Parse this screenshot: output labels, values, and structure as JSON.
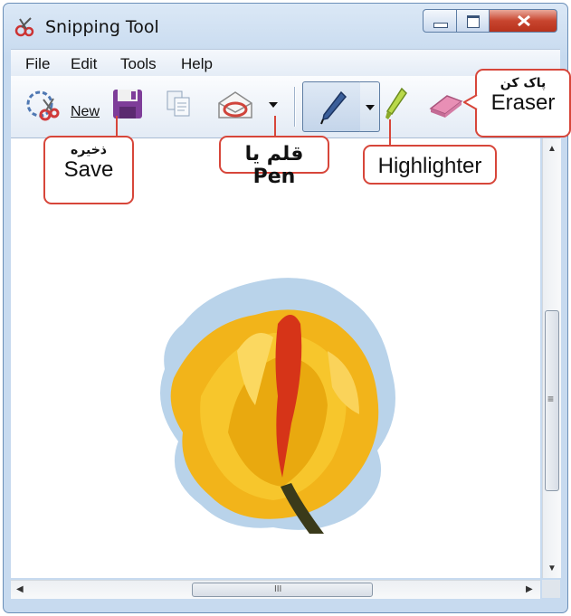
{
  "window": {
    "title": "Snipping Tool"
  },
  "menu": {
    "items": [
      {
        "label": "File"
      },
      {
        "label": "Edit"
      },
      {
        "label": "Tools"
      },
      {
        "label": "Help"
      }
    ]
  },
  "toolbar": {
    "new_label": "New",
    "icons": [
      "new-snip-icon",
      "save-icon",
      "copy-icon",
      "send-snip-icon",
      "dropdown-arrow-icon",
      "pen-icon",
      "highlighter-icon",
      "eraser-icon"
    ]
  },
  "callouts": {
    "save": {
      "fa": "ذخیره",
      "en": "Save"
    },
    "pen": {
      "text": "قلم یا Pen"
    },
    "highlighter": {
      "en": "Highlighter"
    },
    "eraser": {
      "fa": "پاک کن",
      "en": "Eraser"
    }
  },
  "scrollbar": {
    "grip": "III",
    "vgrip": "≡"
  },
  "colors": {
    "callout_border": "#d7463a",
    "title_bg": "#c7daef",
    "close_btn": "#c8452f"
  }
}
